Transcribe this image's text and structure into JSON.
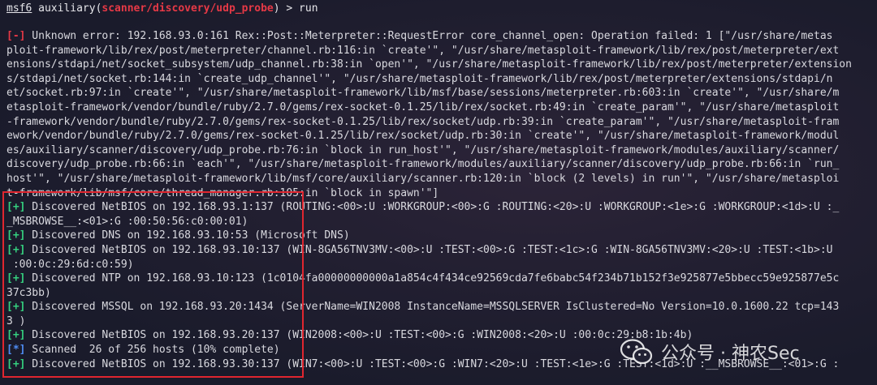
{
  "prompt": {
    "msf": "msf6",
    "word": " auxiliary(",
    "module": "scanner/discovery/udp_probe",
    "suffix": ") > run"
  },
  "lines": [
    {
      "tag": "[-]",
      "kind": "err",
      "text": " Unknown error: 192.168.93.0:161 Rex::Post::Meterpreter::RequestError core_channel_open: Operation failed: 1 [\"/usr/share/metas"
    },
    {
      "tag": "",
      "kind": "",
      "text": "ploit-framework/lib/rex/post/meterpreter/channel.rb:116:in `create'\", \"/usr/share/metasploit-framework/lib/rex/post/meterpreter/ext"
    },
    {
      "tag": "",
      "kind": "",
      "text": "ensions/stdapi/net/socket_subsystem/udp_channel.rb:38:in `open'\", \"/usr/share/metasploit-framework/lib/rex/post/meterpreter/extension"
    },
    {
      "tag": "",
      "kind": "",
      "text": "s/stdapi/net/socket.rb:144:in `create_udp_channel'\", \"/usr/share/metasploit-framework/lib/rex/post/meterpreter/extensions/stdapi/n"
    },
    {
      "tag": "",
      "kind": "",
      "text": "et/socket.rb:97:in `create'\", \"/usr/share/metasploit-framework/lib/msf/base/sessions/meterpreter.rb:603:in `create'\", \"/usr/share/m"
    },
    {
      "tag": "",
      "kind": "",
      "text": "etasploit-framework/vendor/bundle/ruby/2.7.0/gems/rex-socket-0.1.25/lib/rex/socket.rb:49:in `create_param'\", \"/usr/share/metasploit"
    },
    {
      "tag": "",
      "kind": "",
      "text": "-framework/vendor/bundle/ruby/2.7.0/gems/rex-socket-0.1.25/lib/rex/socket/udp.rb:39:in `create_param'\", \"/usr/share/metasploit-fram"
    },
    {
      "tag": "",
      "kind": "",
      "text": "ework/vendor/bundle/ruby/2.7.0/gems/rex-socket-0.1.25/lib/rex/socket/udp.rb:30:in `create'\", \"/usr/share/metasploit-framework/modul"
    },
    {
      "tag": "",
      "kind": "",
      "text": "es/auxiliary/scanner/discovery/udp_probe.rb:76:in `block in run_host'\", \"/usr/share/metasploit-framework/modules/auxiliary/scanner/"
    },
    {
      "tag": "",
      "kind": "",
      "text": "discovery/udp_probe.rb:66:in `each'\", \"/usr/share/metasploit-framework/modules/auxiliary/scanner/discovery/udp_probe.rb:66:in `run_"
    },
    {
      "tag": "",
      "kind": "",
      "text": "host'\", \"/usr/share/metasploit-framework/lib/msf/core/auxiliary/scanner.rb:120:in `block (2 levels) in run'\", \"/usr/share/metasploi"
    },
    {
      "tag": "",
      "kind": "",
      "text": "t-framework/lib/msf/core/thread_manager.rb:105:in `block in spawn'\"]"
    },
    {
      "tag": "[+]",
      "kind": "ok",
      "text": " Discovered NetBIOS on 192.168.93.1:137 (ROUTING:<00>:U :WORKGROUP:<00>:G :ROUTING:<20>:U :WORKGROUP:<1e>:G :WORKGROUP:<1d>:U :_"
    },
    {
      "tag": "",
      "kind": "",
      "text": "_MSBROWSE__:<01>:G :00:50:56:c0:00:01)"
    },
    {
      "tag": "[+]",
      "kind": "ok",
      "text": " Discovered DNS on 192.168.93.10:53 (Microsoft DNS)"
    },
    {
      "tag": "[+]",
      "kind": "ok",
      "text": " Discovered NetBIOS on 192.168.93.10:137 (WIN-8GA56TNV3MV:<00>:U :TEST:<00>:G :TEST:<1c>:G :WIN-8GA56TNV3MV:<20>:U :TEST:<1b>:U"
    },
    {
      "tag": "",
      "kind": "",
      "text": " :00:0c:29:6d:c0:59)"
    },
    {
      "tag": "[+]",
      "kind": "ok",
      "text": " Discovered NTP on 192.168.93.10:123 (1c0104fa00000000000a1a854c4f434ce92569cda7fe6babc54f234b71b152f3e925877e5bbecc59e925877e5c"
    },
    {
      "tag": "",
      "kind": "",
      "text": "37c3bb)"
    },
    {
      "tag": "[+]",
      "kind": "ok",
      "text": " Discovered MSSQL on 192.168.93.20:1434 (ServerName=WIN2008 InstanceName=MSSQLSERVER IsClustered=No Version=10.0.1600.22 tcp=143"
    },
    {
      "tag": "",
      "kind": "",
      "text": "3 )"
    },
    {
      "tag": "[+]",
      "kind": "ok",
      "text": " Discovered NetBIOS on 192.168.93.20:137 (WIN2008:<00>:U :TEST:<00>:G :WIN2008:<20>:U :00:0c:29:b8:1b:4b)"
    },
    {
      "tag": "[*]",
      "kind": "info",
      "text": " Scanned  26 of 256 hosts (10% complete)"
    },
    {
      "tag": "[+]",
      "kind": "ok",
      "text": " Discovered NetBIOS on 192.168.93.30:137 (WIN7:<00>:U :TEST:<00>:G :WIN7:<20>:U :TEST:<1e>:G :TEST:<1d>:U :__MSBROWSE__:<01>:G :"
    }
  ],
  "watermark": {
    "text": "公众号 · 神农Sec",
    "icon": "wechat-icon"
  },
  "colors": {
    "background": "#1a1b2b",
    "text": "#d9d9df",
    "error_tag": "#e63946",
    "success_tag": "#35d07f",
    "info_tag": "#4f8df5",
    "highlight_box": "#e0262f"
  }
}
